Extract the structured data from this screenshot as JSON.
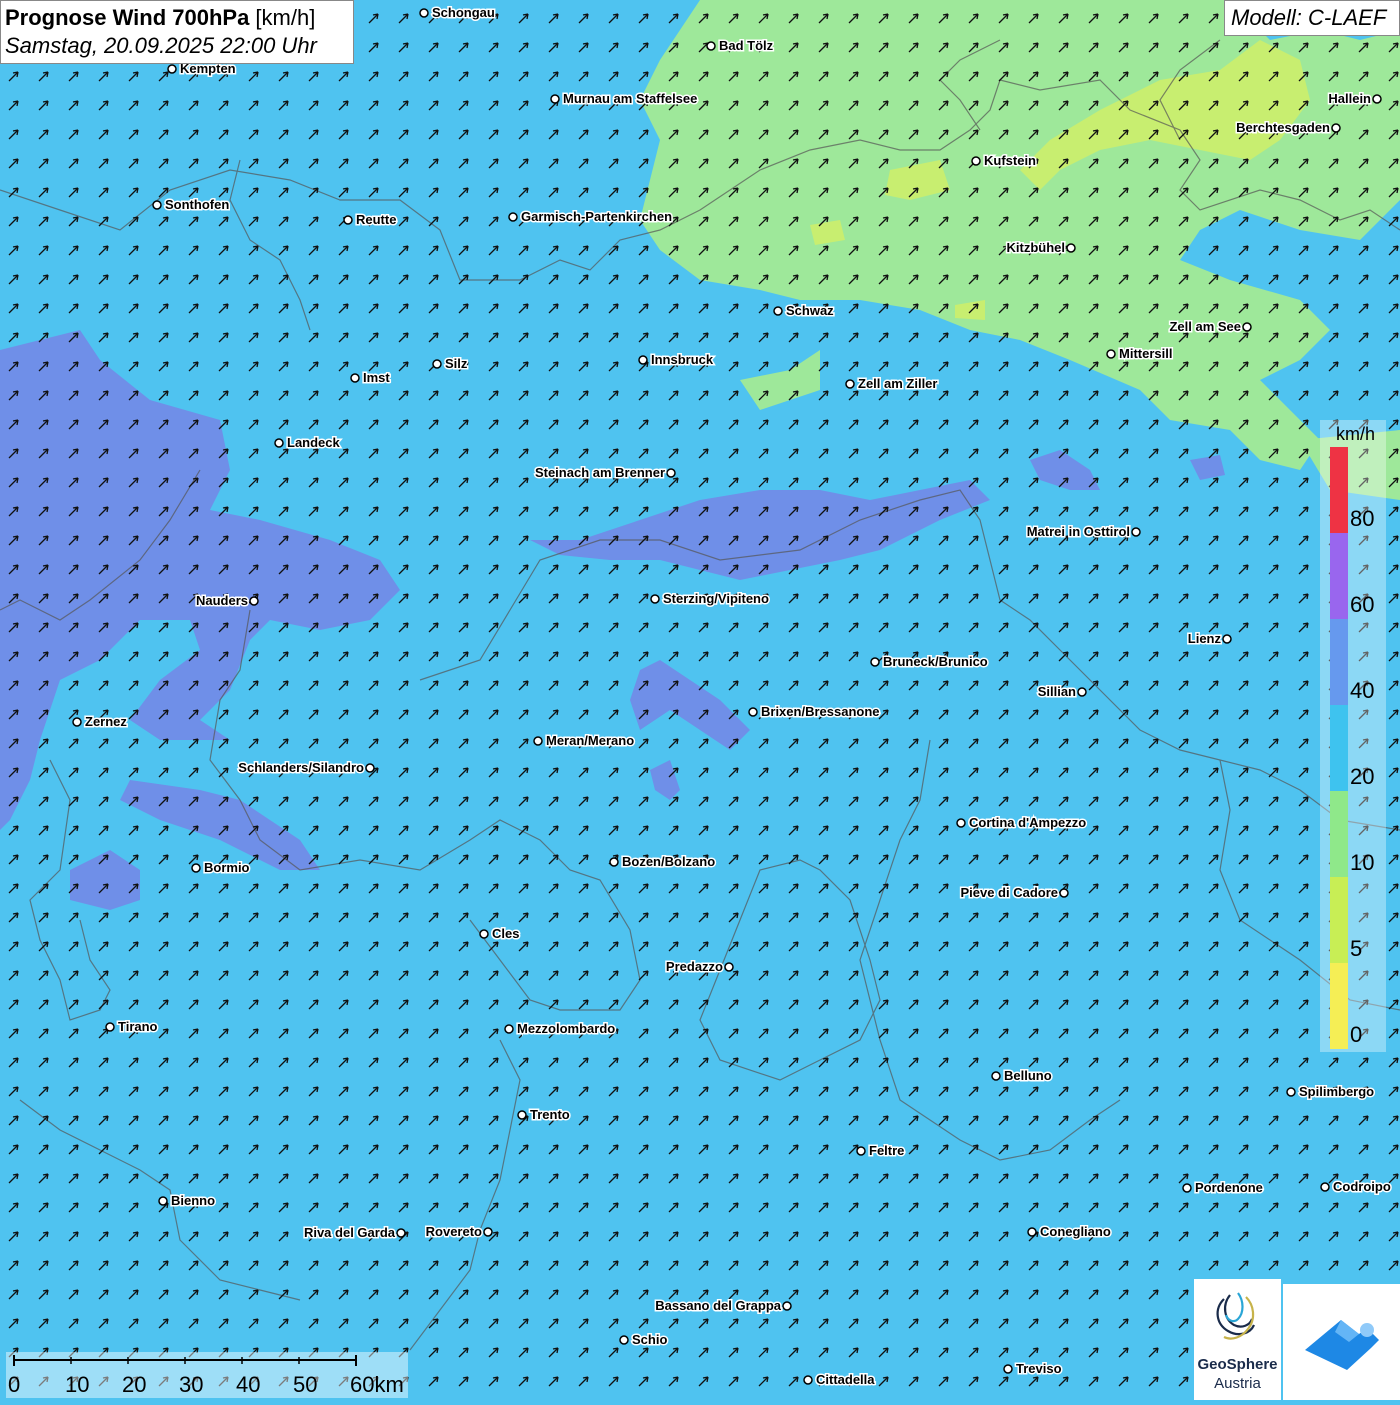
{
  "header": {
    "title_bold": "Prognose Wind 700hPa",
    "title_unit": " [km/h]",
    "subtitle": "Samstag, 20.09.2025 22:00 Uhr"
  },
  "model": {
    "label": "Modell: C-LAEF"
  },
  "legend": {
    "unit": "km/h",
    "ticks": [
      "80",
      "60",
      "40",
      "20",
      "10",
      "5",
      "0"
    ],
    "bands": [
      {
        "color": "#f5ee55",
        "range": "0-5"
      },
      {
        "color": "#c8ee55",
        "range": "5-10"
      },
      {
        "color": "#8fe88a",
        "range": "10-20"
      },
      {
        "color": "#3ec3ef",
        "range": "20-40"
      },
      {
        "color": "#6699ee",
        "range": "40-60"
      },
      {
        "color": "#9966ee",
        "range": "60-80"
      },
      {
        "color": "#ee3344",
        "range": "80+"
      }
    ]
  },
  "scale": {
    "labels": [
      "0",
      "10",
      "20",
      "30",
      "40",
      "50",
      "60km"
    ]
  },
  "wind": {
    "direction": "south-west",
    "arrow_color": "#111111"
  },
  "cities": [
    {
      "name": "Schongau"
    },
    {
      "name": "Bad Tölz"
    },
    {
      "name": "Kempten"
    },
    {
      "name": "Murnau am Staffelsee"
    },
    {
      "name": "Hallein"
    },
    {
      "name": "Berchtesgaden"
    },
    {
      "name": "Kufstein"
    },
    {
      "name": "Sonthofen"
    },
    {
      "name": "Reutte"
    },
    {
      "name": "Garmisch-Partenkirchen"
    },
    {
      "name": "Kitzbühel"
    },
    {
      "name": "Schwaz"
    },
    {
      "name": "Zell am See"
    },
    {
      "name": "Innsbruck"
    },
    {
      "name": "Mittersill"
    },
    {
      "name": "Imst"
    },
    {
      "name": "Silz"
    },
    {
      "name": "Zell am Ziller"
    },
    {
      "name": "Landeck"
    },
    {
      "name": "Steinach am Brenner"
    },
    {
      "name": "Matrei in Osttirol"
    },
    {
      "name": "Nauders"
    },
    {
      "name": "Sterzing/Vipiteno"
    },
    {
      "name": "Lienz"
    },
    {
      "name": "Bruneck/Brunico"
    },
    {
      "name": "Sillian"
    },
    {
      "name": "Brixen/Bressanone"
    },
    {
      "name": "Zernez"
    },
    {
      "name": "Meran/Merano"
    },
    {
      "name": "Schlanders/Silandro"
    },
    {
      "name": "Cortina d'Ampezzo"
    },
    {
      "name": "Bozen/Bolzano"
    },
    {
      "name": "Bormio"
    },
    {
      "name": "Pieve di Cadore"
    },
    {
      "name": "Cles"
    },
    {
      "name": "Predazzo"
    },
    {
      "name": "Tirano"
    },
    {
      "name": "Mezzolombardo"
    },
    {
      "name": "Belluno"
    },
    {
      "name": "Spilimbergo"
    },
    {
      "name": "Trento"
    },
    {
      "name": "Feltre"
    },
    {
      "name": "Pordenone"
    },
    {
      "name": "Codroipo"
    },
    {
      "name": "Bienno"
    },
    {
      "name": "Riva del Garda"
    },
    {
      "name": "Rovereto"
    },
    {
      "name": "Conegliano"
    },
    {
      "name": "Bassano del Grappa"
    },
    {
      "name": "Schio"
    },
    {
      "name": "Treviso"
    },
    {
      "name": "Cittadella"
    }
  ],
  "logos": {
    "geosphere_line1": "GeoSphere",
    "geosphere_line2": "Austria"
  }
}
